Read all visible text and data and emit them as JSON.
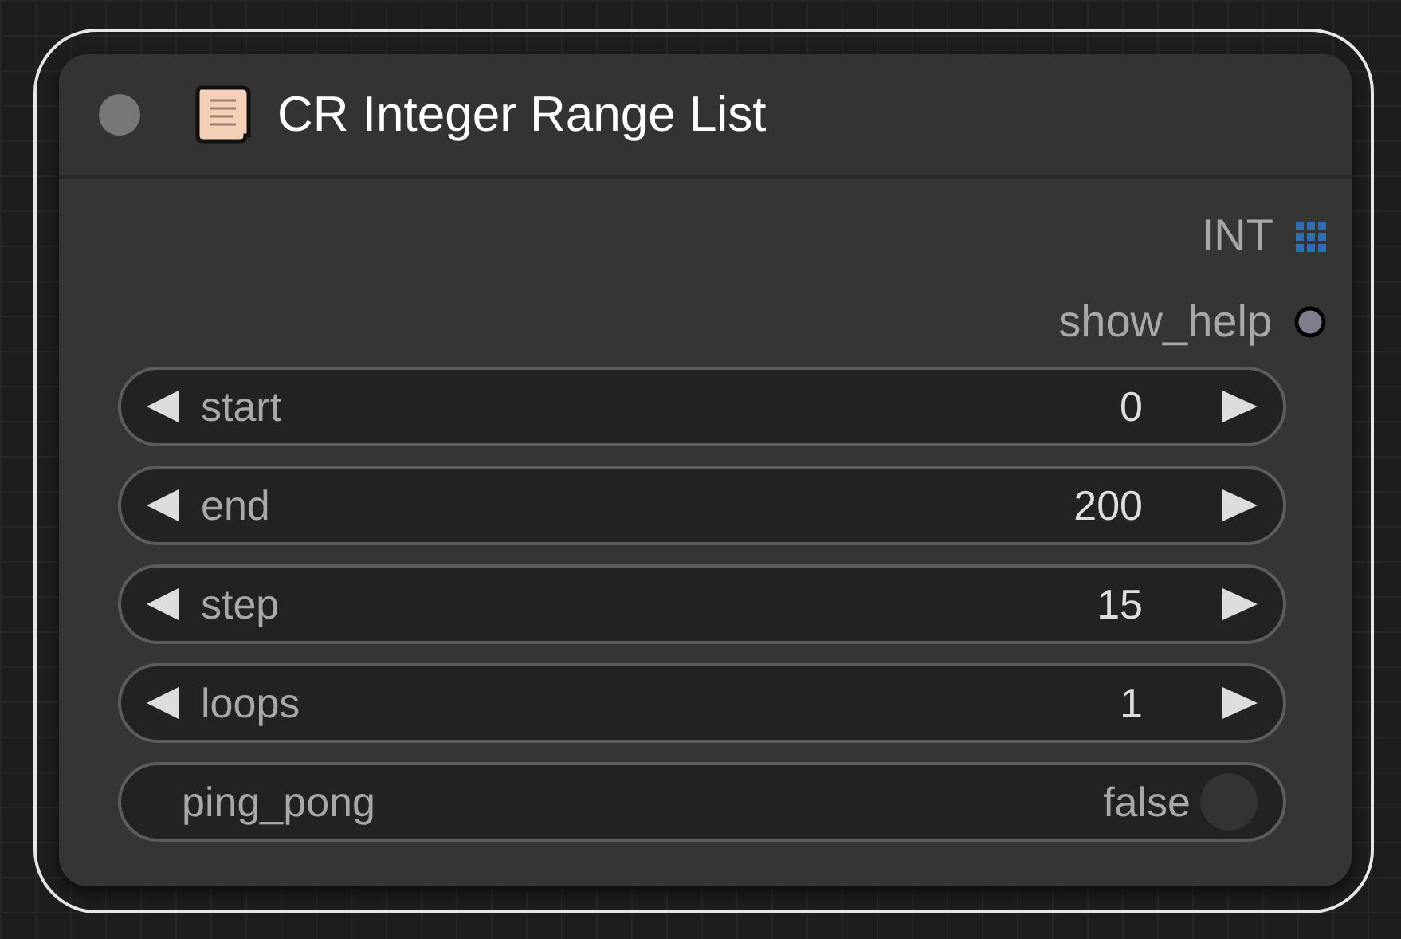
{
  "node": {
    "title": "CR Integer Range List",
    "selected": true,
    "outputs": [
      {
        "label": "INT",
        "kind": "grid",
        "color": "#2d6fb0"
      },
      {
        "label": "show_help",
        "kind": "dot",
        "color": "#7e7e8e"
      }
    ],
    "widgets": [
      {
        "kind": "number",
        "label": "start",
        "value": "0"
      },
      {
        "kind": "number",
        "label": "end",
        "value": "200"
      },
      {
        "kind": "number",
        "label": "step",
        "value": "15"
      },
      {
        "kind": "number",
        "label": "loops",
        "value": "1"
      },
      {
        "kind": "toggle",
        "label": "ping_pong",
        "value": "false",
        "on": false
      }
    ]
  }
}
